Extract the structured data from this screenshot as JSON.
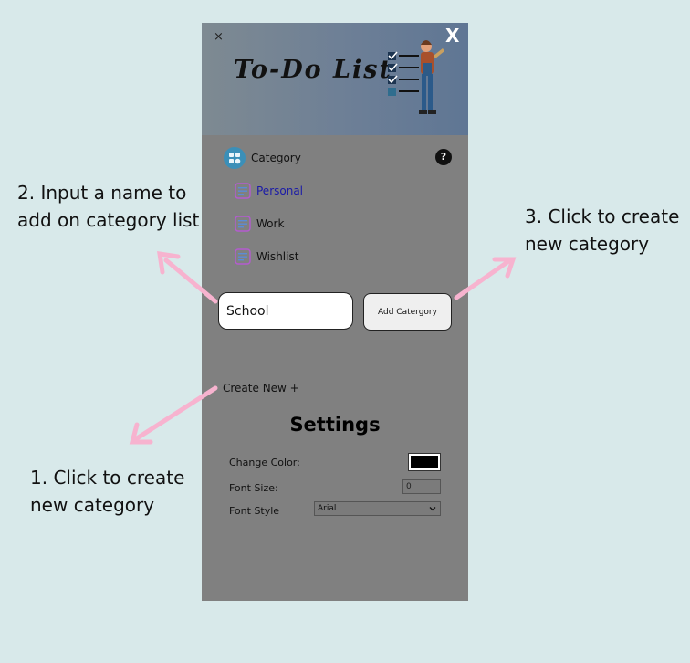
{
  "callouts": {
    "step1": [
      "1. Click to create",
      "new category"
    ],
    "step2": [
      "2. Input a name to",
      "add on category list"
    ],
    "step3": [
      "3. Click to create",
      "new category"
    ]
  },
  "header": {
    "title": "To-Do List",
    "small_close": "×",
    "big_close": "X"
  },
  "category": {
    "title": "Category",
    "help": "?",
    "items": [
      {
        "label": "Personal",
        "active": true
      },
      {
        "label": "Work",
        "active": false
      },
      {
        "label": "Wishlist",
        "active": false
      }
    ],
    "input_value": "School",
    "add_button": "Add Catergory",
    "create_new": "Create New +"
  },
  "settings": {
    "title": "Settings",
    "change_color_label": "Change Color:",
    "color_value": "#000000",
    "font_size_label": "Font Size:",
    "font_size_value": "0",
    "font_style_label": "Font Style",
    "font_style_value": "Arial"
  },
  "colors": {
    "background": "#d8e9ea",
    "panel": "#808080",
    "arrow": "#f7b3cf",
    "active_item": "#1a1aa8"
  }
}
